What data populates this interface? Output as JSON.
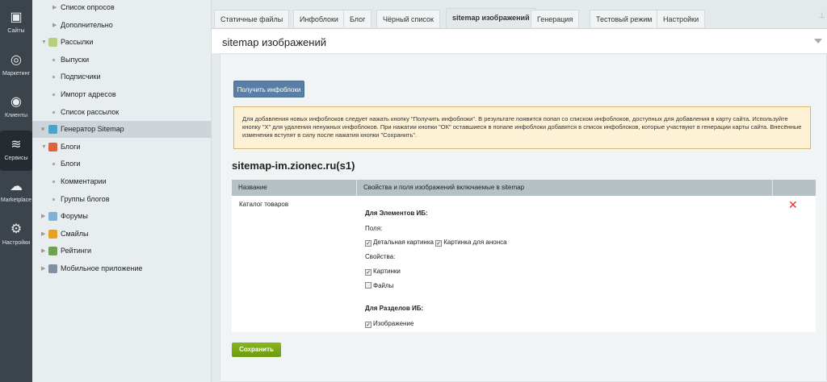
{
  "left_nav": [
    {
      "label": "Сайты",
      "icon": "calendar-24-icon"
    },
    {
      "label": "Маркетинг",
      "icon": "target-icon"
    },
    {
      "label": "Клиенты",
      "icon": "clients-24-icon"
    },
    {
      "label": "Сервисы",
      "icon": "layers-icon",
      "active": true
    },
    {
      "label": "Marketplace",
      "icon": "cloud-download-icon"
    },
    {
      "label": "Настройки",
      "icon": "gear-icon"
    }
  ],
  "menu": [
    {
      "label": "Список опросов",
      "level": 2,
      "type": "arrow"
    },
    {
      "label": "Дополнительно",
      "level": 2,
      "type": "arrow"
    },
    {
      "label": "Рассылки",
      "level": 1,
      "type": "open",
      "icon": "mail-icon",
      "color": "#b5cf7a"
    },
    {
      "label": "Выпуски",
      "level": 2,
      "type": "dot"
    },
    {
      "label": "Подписчики",
      "level": 2,
      "type": "dot"
    },
    {
      "label": "Импорт адресов",
      "level": 2,
      "type": "dot"
    },
    {
      "label": "Список рассылок",
      "level": 2,
      "type": "dot"
    },
    {
      "label": "Генератор Sitemap",
      "level": 1,
      "type": "dot",
      "icon": "sitemap-icon",
      "color": "#4aa3c8",
      "selected": true
    },
    {
      "label": "Блоги",
      "level": 1,
      "type": "open",
      "icon": "blog-icon",
      "color": "#e06040"
    },
    {
      "label": "Блоги",
      "level": 2,
      "type": "dot"
    },
    {
      "label": "Комментарии",
      "level": 2,
      "type": "dot"
    },
    {
      "label": "Группы блогов",
      "level": 2,
      "type": "dot"
    },
    {
      "label": "Форумы",
      "level": 1,
      "type": "arrow",
      "icon": "forum-icon",
      "color": "#7fb2d8"
    },
    {
      "label": "Смайлы",
      "level": 1,
      "type": "arrow",
      "icon": "smile-icon",
      "color": "#e8a020"
    },
    {
      "label": "Рейтинги",
      "level": 1,
      "type": "arrow",
      "icon": "rating-icon",
      "color": "#70a050"
    },
    {
      "label": "Мобильное приложение",
      "level": 1,
      "type": "arrow",
      "icon": "mobile-icon",
      "color": "#8090a0"
    }
  ],
  "tabs": [
    "Статичные файлы",
    "Инфоблоки",
    "Блог",
    "Чёрный список",
    "sitemap изображений",
    "Генерация",
    "Тестовый режим",
    "Настройки"
  ],
  "active_tab": 4,
  "page_title": "sitemap изображений",
  "get_button": "Получить инфоблоки",
  "note": "Для добавления новых инфоблоков следует нажать кнопку \"Получить инфоблоки\". В результате появится попап со списком инфоблоков, доступных для добавления в карту сайта. Используйте кнопку \"X\" для удаления ненужных инфоблоков. При нажатии кнопки \"ОК\" оставшиеся в попапе инфоблоки добавятся в список инфоблоков, которые участвуют в генерации карты сайта. Внесённые изменения вступят в силу после нажатия кнопки \"Сохранить\".",
  "site_title": "sitemap-im.zionec.ru(s1)",
  "table": {
    "headers": [
      "Название",
      "Свойства и поля изображений включаемые в sitemap",
      ""
    ],
    "row": {
      "name": "Каталог товаров",
      "elements_heading": "Для Элементов ИБ:",
      "fields_label": "Поля:",
      "fields": [
        {
          "label": "Детальная картинка",
          "checked": true
        },
        {
          "label": "Картинка для анонса",
          "checked": true
        }
      ],
      "props_label": "Свойства:",
      "props": [
        {
          "label": "Картинки",
          "checked": true
        },
        {
          "label": "Файлы",
          "checked": false
        }
      ],
      "sections_heading": "Для Разделов ИБ:",
      "sections": [
        {
          "label": "Изображение",
          "checked": true
        }
      ],
      "delete": "✕"
    }
  },
  "save_button": "Сохранить"
}
